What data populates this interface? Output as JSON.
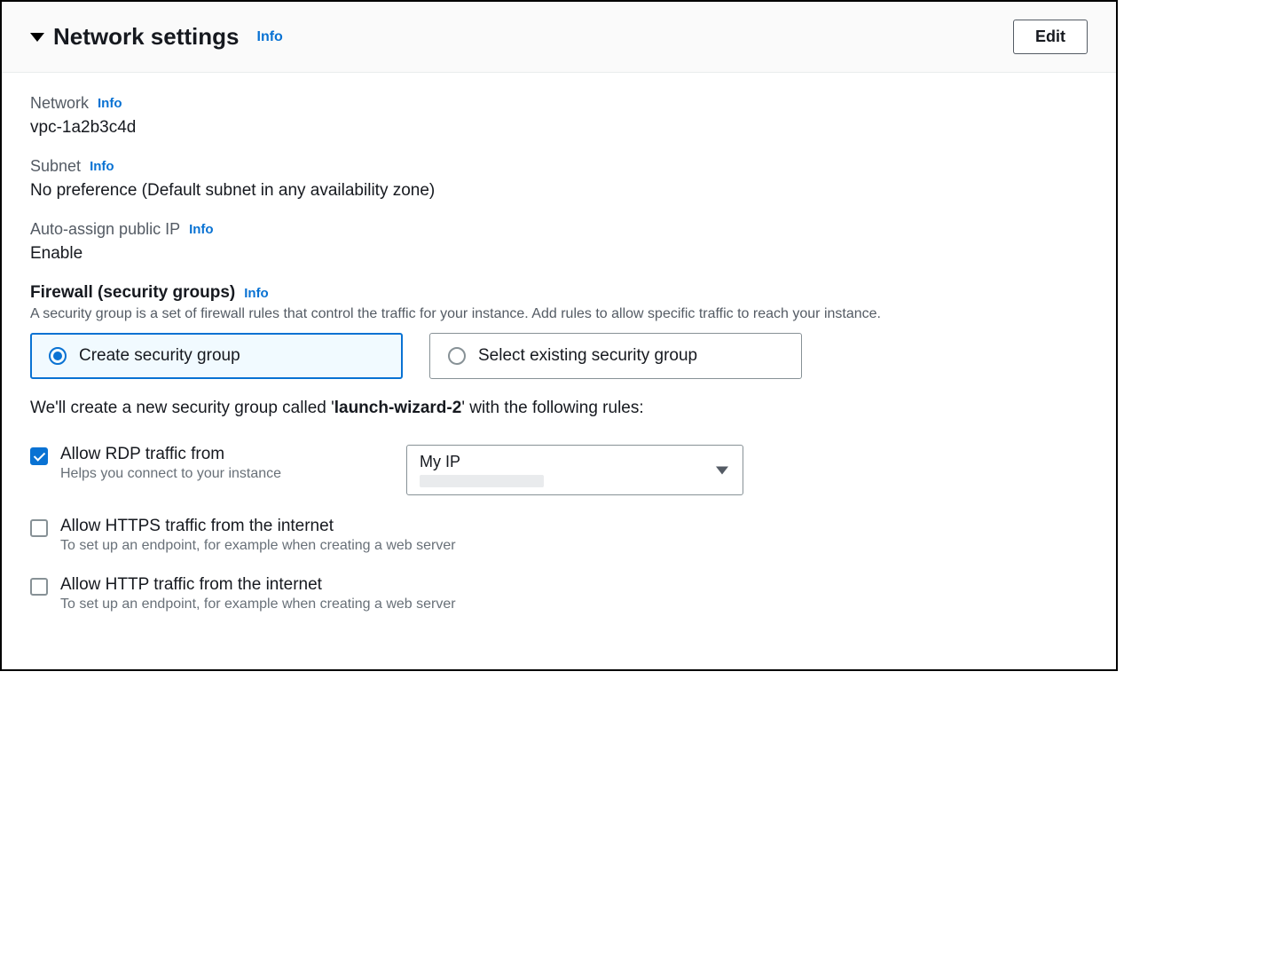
{
  "header": {
    "title": "Network settings",
    "info_label": "Info",
    "edit_label": "Edit"
  },
  "network": {
    "label": "Network",
    "info_label": "Info",
    "value": "vpc-1a2b3c4d"
  },
  "subnet": {
    "label": "Subnet",
    "info_label": "Info",
    "value": "No preference (Default subnet in any availability zone)"
  },
  "auto_assign": {
    "label": "Auto-assign public IP",
    "info_label": "Info",
    "value": "Enable"
  },
  "firewall": {
    "label": "Firewall (security groups)",
    "info_label": "Info",
    "description": "A security group is a set of firewall rules that control the traffic for your instance. Add rules to allow specific traffic to reach your instance.",
    "options": {
      "create": "Create security group",
      "select_existing": "Select existing security group"
    }
  },
  "create_sg": {
    "prefix": "We'll create a new security group called '",
    "name": "launch-wizard-2",
    "suffix": "' with the following rules:"
  },
  "rules": {
    "rdp": {
      "label": "Allow RDP traffic from",
      "description": "Helps you connect to your instance",
      "select_value": "My IP"
    },
    "https": {
      "label": "Allow HTTPS traffic from the internet",
      "description": "To set up an endpoint, for example when creating a web server"
    },
    "http": {
      "label": "Allow HTTP traffic from the internet",
      "description": "To set up an endpoint, for example when creating a web server"
    }
  }
}
